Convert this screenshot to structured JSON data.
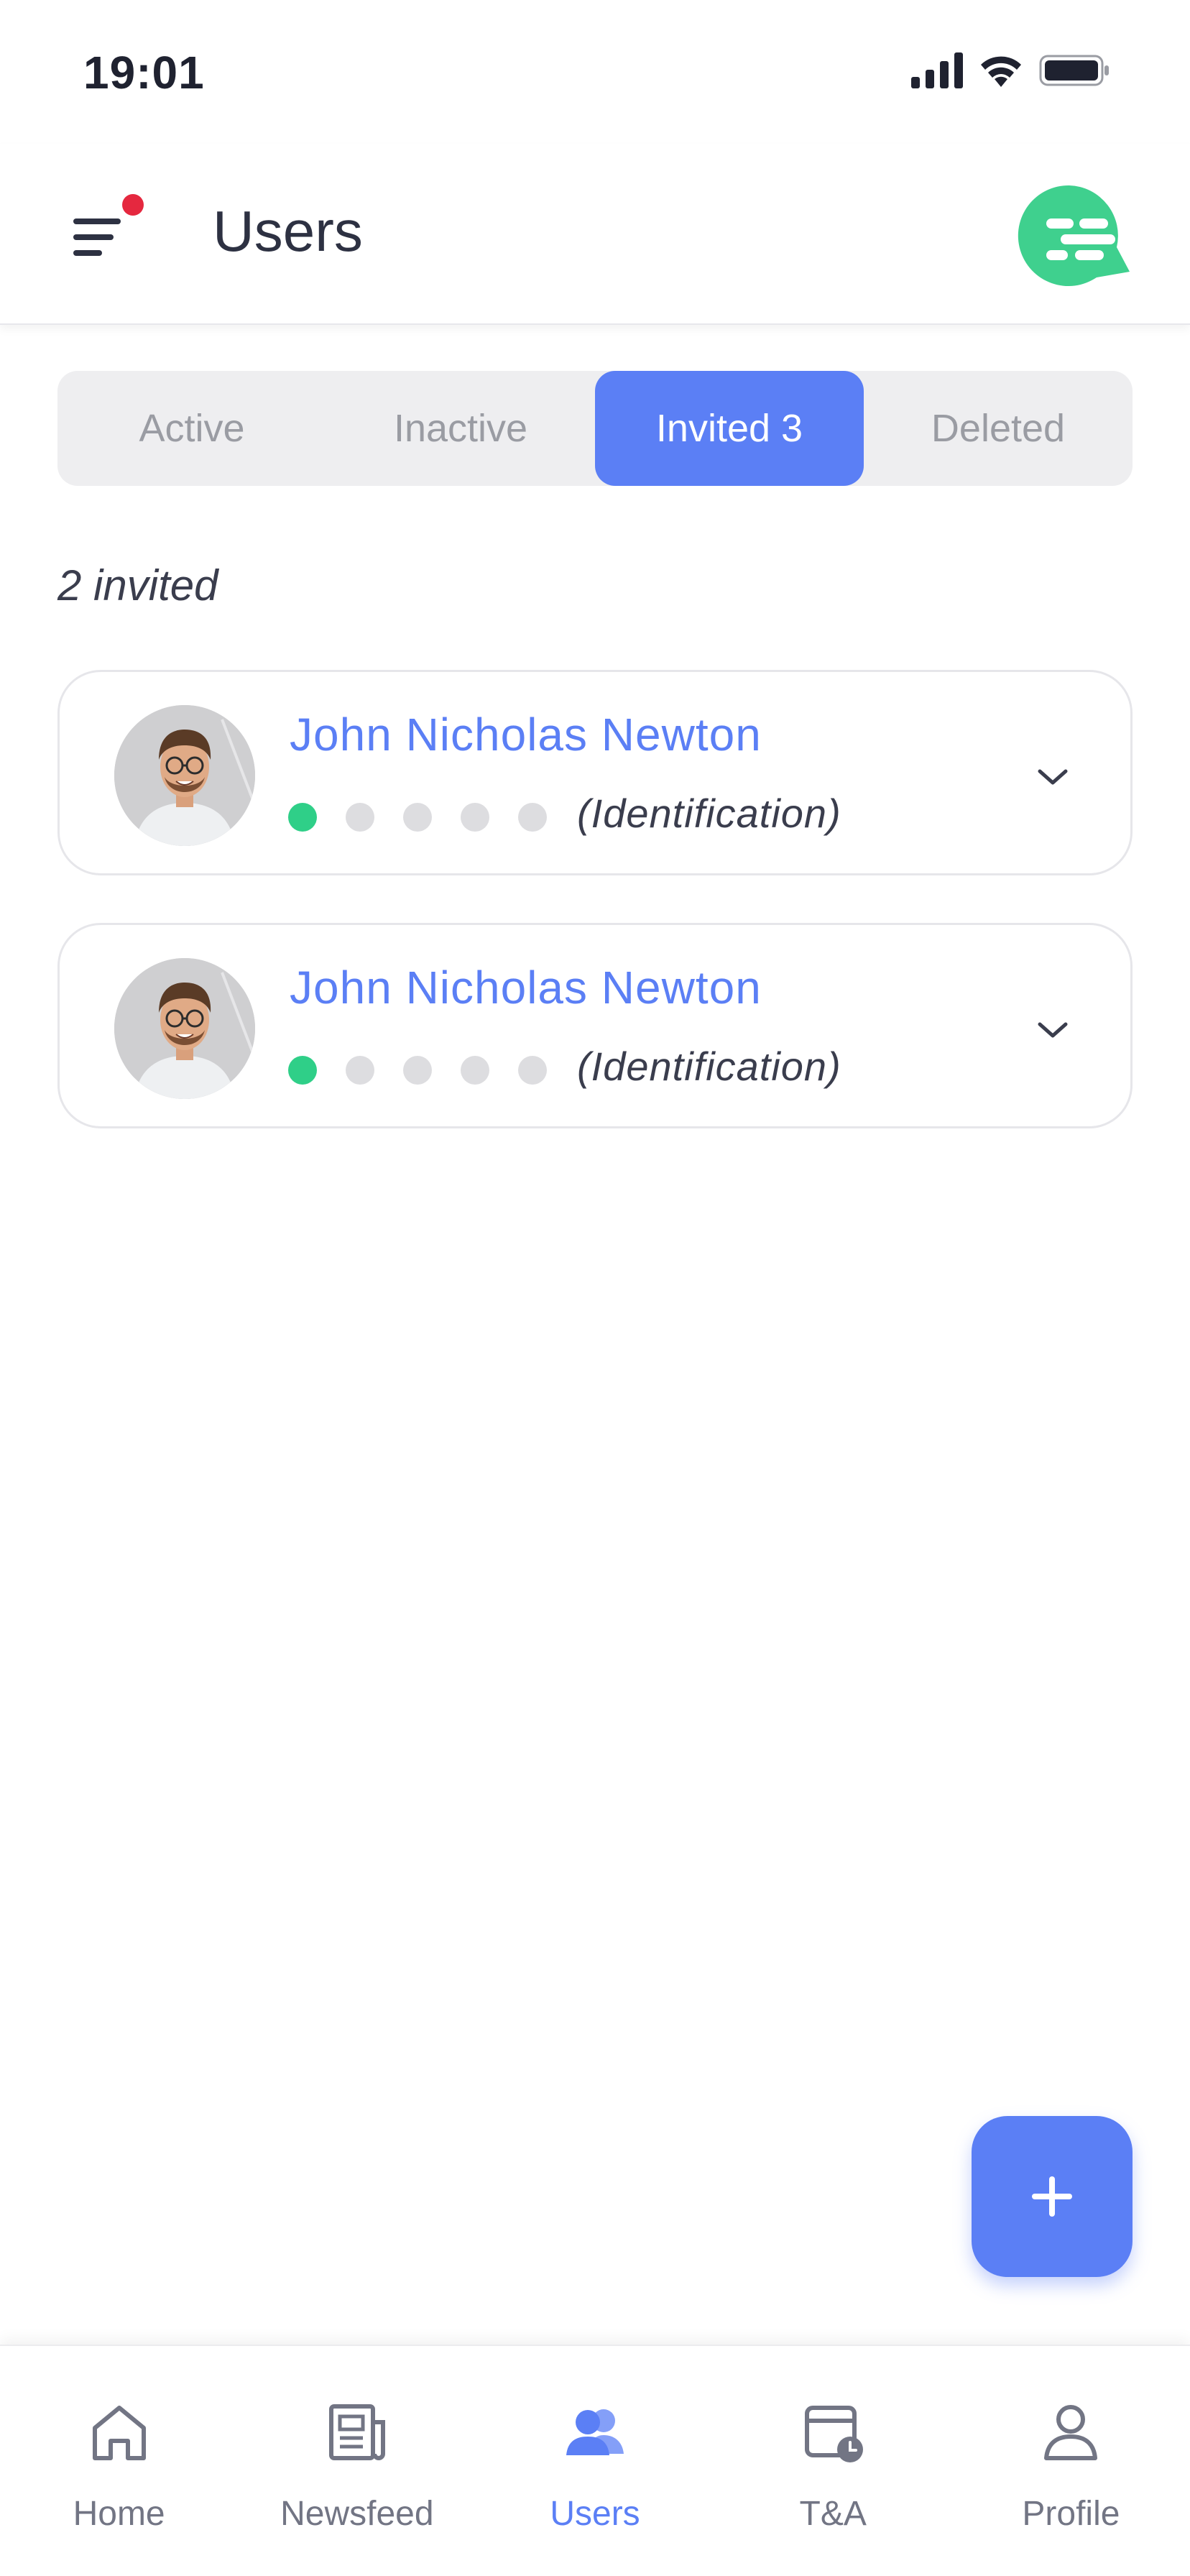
{
  "status_bar": {
    "time": "19:01"
  },
  "header": {
    "title": "Users"
  },
  "tabs": [
    {
      "label": "Active"
    },
    {
      "label": "Inactive"
    },
    {
      "label": "Invited 3"
    },
    {
      "label": "Deleted"
    }
  ],
  "selected_tab": "Invited 3",
  "count_label": "2 invited",
  "users": [
    {
      "name": "John Nicholas Newton",
      "stage": "(Identification)",
      "steps_completed": 1,
      "steps_total": 5
    },
    {
      "name": "John Nicholas Newton",
      "stage": "(Identification)",
      "steps_completed": 1,
      "steps_total": 5
    }
  ],
  "fab": {
    "icon": "plus-icon"
  },
  "bottom_nav": [
    {
      "label": "Home",
      "icon": "home-icon"
    },
    {
      "label": "Newsfeed",
      "icon": "newspaper-icon"
    },
    {
      "label": "Users",
      "icon": "users-icon"
    },
    {
      "label": "T&A",
      "icon": "calendar-clock-icon"
    },
    {
      "label": "Profile",
      "icon": "profile-icon"
    }
  ],
  "colors": {
    "accent": "#5b7ff5",
    "success": "#2fcf88",
    "notification": "#e5283f",
    "brand_chat": "#3fd08e"
  }
}
